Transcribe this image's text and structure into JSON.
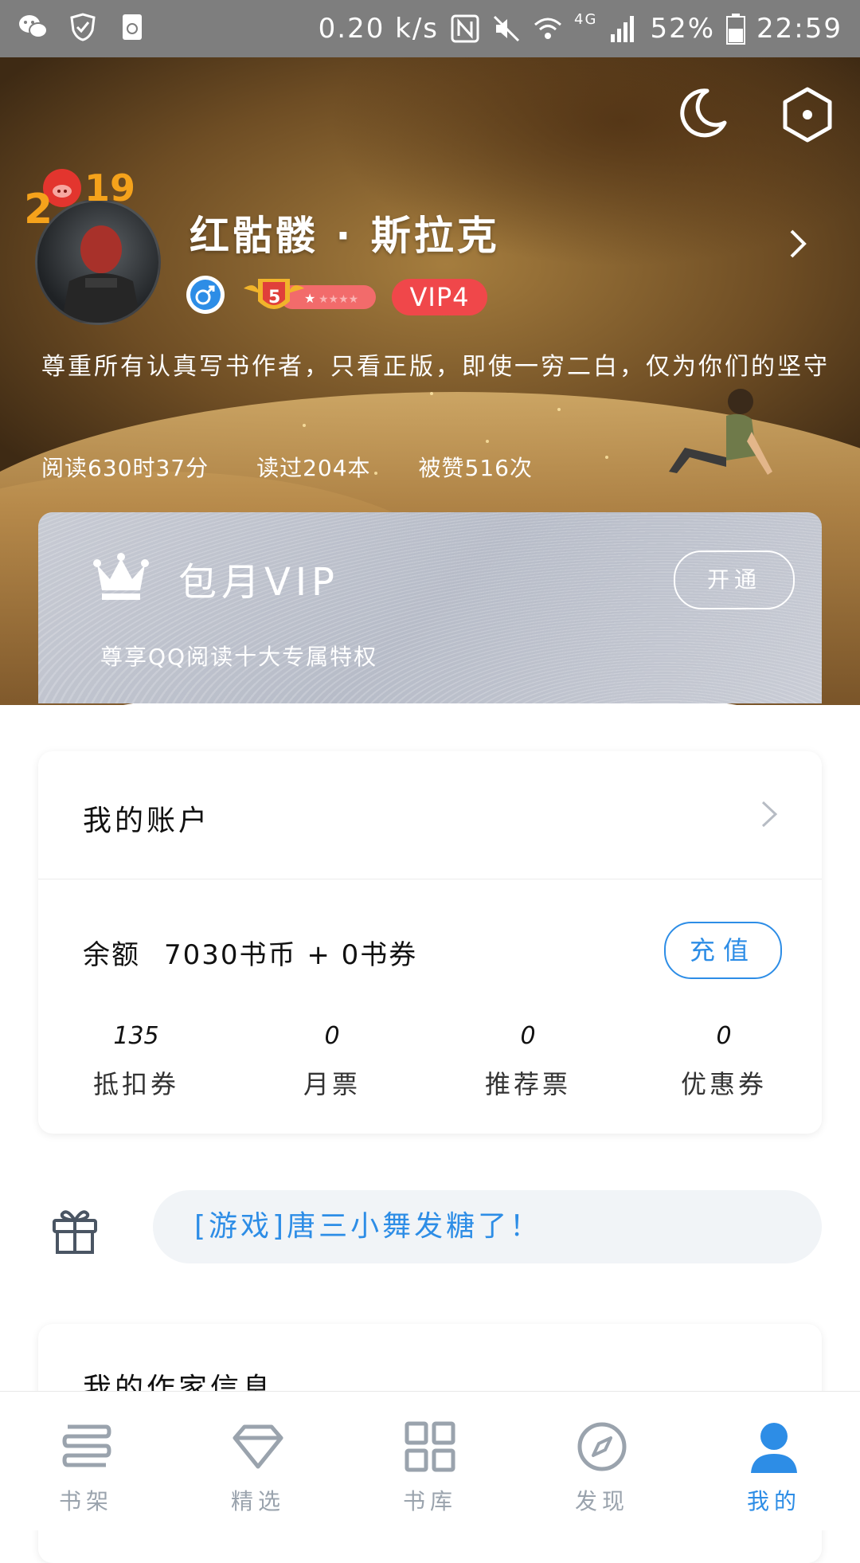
{
  "status_bar": {
    "speed": "0.20 k/s",
    "network": "4G",
    "battery": "52%",
    "time": "22:59"
  },
  "profile": {
    "year_badge": "2019",
    "name": "红骷髅 · 斯拉克",
    "level": "5",
    "vip_label": "VIP4",
    "bio": "尊重所有认真写书作者，只看正版，即使一穷二白，仅为你们的坚守",
    "stats": [
      "阅读630时37分",
      "读过204本",
      "被赞516次"
    ]
  },
  "vip_card": {
    "title": "包月VIP",
    "subtitle": "尊享QQ阅读十大专属特权",
    "button": "开通"
  },
  "account": {
    "title": "我的账户",
    "balance_label": "余额",
    "balance_value": "7030书币 + 0书券",
    "recharge_button": "充值",
    "counts": [
      {
        "num": "135",
        "label": "抵扣券"
      },
      {
        "num": "0",
        "label": "月票"
      },
      {
        "num": "0",
        "label": "推荐票"
      },
      {
        "num": "0",
        "label": "优惠券"
      }
    ]
  },
  "promo": {
    "text": "[游戏]唐三小舞发糖了！"
  },
  "author": {
    "title": "我的作家信息"
  },
  "nav": [
    {
      "label": "书架",
      "icon": "bookshelf-icon"
    },
    {
      "label": "精选",
      "icon": "diamond-icon"
    },
    {
      "label": "书库",
      "icon": "grid-icon"
    },
    {
      "label": "发现",
      "icon": "compass-icon"
    },
    {
      "label": "我的",
      "icon": "profile-icon"
    }
  ],
  "colors": {
    "accent": "#2d8de6",
    "vip_red": "#f0474a",
    "nav_inactive": "#9aa3ad"
  }
}
